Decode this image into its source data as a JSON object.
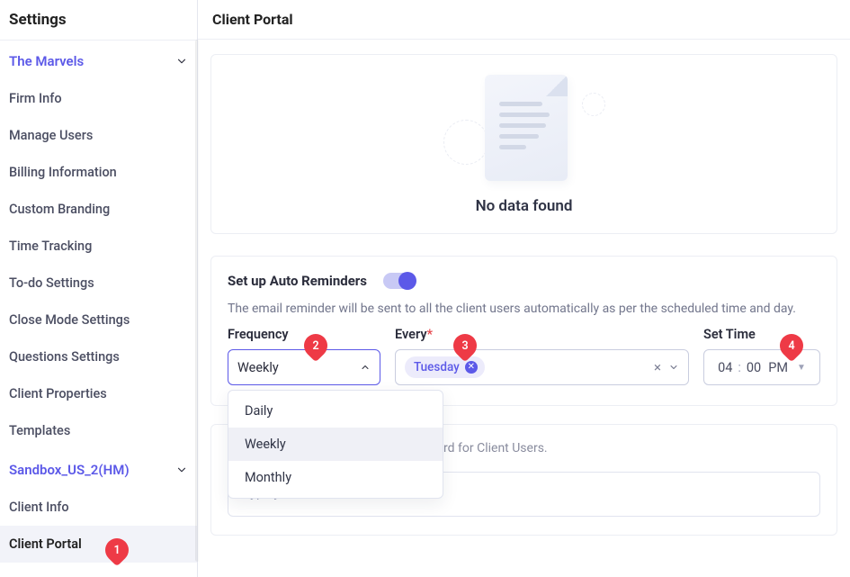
{
  "sidebar": {
    "title": "Settings",
    "sections": [
      {
        "label": "The Marvels",
        "items": [
          "Firm Info",
          "Manage Users",
          "Billing Information",
          "Custom Branding",
          "Time Tracking",
          "To-do Settings",
          "Close Mode Settings",
          "Questions Settings",
          "Client Properties",
          "Templates"
        ]
      },
      {
        "label": "Sandbox_US_2(HM)",
        "items": [
          "Client Info",
          "Client Portal"
        ]
      }
    ],
    "active": "Client Portal"
  },
  "main": {
    "title": "Client Portal",
    "empty_text": "No data found"
  },
  "reminders": {
    "title": "Set up Auto Reminders",
    "toggle_on": true,
    "description": "The email reminder will be sent to all the client users automatically as per the scheduled time and day.",
    "frequency_label": "Frequency",
    "frequency_value": "Weekly",
    "frequency_options": [
      "Daily",
      "Weekly",
      "Monthly"
    ],
    "every_label": "Every",
    "every_required": "*",
    "every_value": "Tuesday",
    "time_label": "Set Time",
    "time_hour": "04",
    "time_min": "00",
    "time_ampm": "PM"
  },
  "notes": {
    "description": "This note will be displayed on dashboard for Client Users.",
    "placeholder": "Type your notes..."
  },
  "annotations": {
    "b1": "1",
    "b2": "2",
    "b3": "3",
    "b4": "4"
  }
}
